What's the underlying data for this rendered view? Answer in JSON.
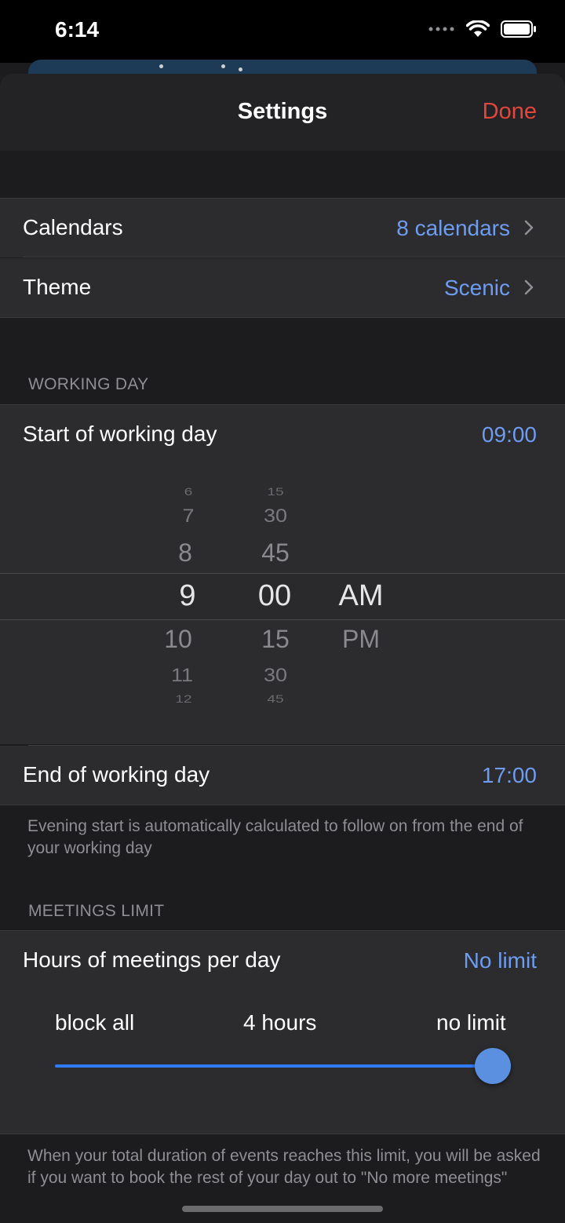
{
  "status": {
    "time": "6:14"
  },
  "nav": {
    "title": "Settings",
    "done_label": "Done"
  },
  "rows": {
    "calendars": {
      "label": "Calendars",
      "value": "8 calendars"
    },
    "theme": {
      "label": "Theme",
      "value": "Scenic"
    }
  },
  "working_day": {
    "header": "WORKING DAY",
    "start_label": "Start of working day",
    "start_value": "09:00",
    "picker": {
      "hours_above": [
        "6",
        "7",
        "8"
      ],
      "hour_selected": "9",
      "hours_below": [
        "10",
        "11",
        "12"
      ],
      "minutes_above": [
        "15",
        "30",
        "45"
      ],
      "minute_selected": "00",
      "minutes_below": [
        "15",
        "30",
        "45"
      ],
      "period_selected": "AM",
      "period_other": "PM"
    },
    "end_label": "End of working day",
    "end_value": "17:00",
    "footnote": "Evening start is automatically calculated to follow on from the end of your working day"
  },
  "meetings": {
    "header": "MEETINGS LIMIT",
    "label": "Hours of meetings per day",
    "value": "No limit",
    "slider": {
      "min_label": "block all",
      "mid_label": "4 hours",
      "max_label": "no limit",
      "position": 1.0
    },
    "footnote": "When your total duration of events reaches this limit, you will be asked if you want to book the rest of your day out to \"No more meetings\""
  },
  "colors": {
    "accent": "#6d9cf0",
    "done": "#e5453a",
    "slider": "#2f7cf6",
    "knob": "#5b8fdf"
  }
}
